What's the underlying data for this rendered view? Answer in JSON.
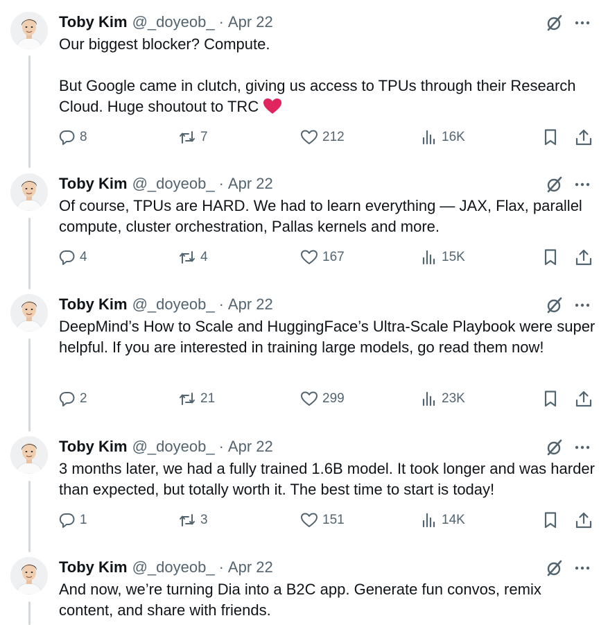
{
  "author": {
    "name": "Toby Kim",
    "handle": "@_doyeob_",
    "separator": "·"
  },
  "icons": {
    "reply": "reply-icon",
    "retweet": "retweet-icon",
    "like": "heart-icon",
    "views": "views-icon",
    "bookmark": "bookmark-icon",
    "share": "share-icon",
    "grok": "grok-icon",
    "more": "more-icon"
  },
  "colors": {
    "text": "#0f1419",
    "muted": "#536471",
    "thread_line": "#cfd9de",
    "heart_emoji": "#e0245e"
  },
  "tweets": [
    {
      "date": "Apr 22",
      "paragraphs": [
        "Our biggest blocker? Compute.",
        "But Google came in clutch, giving us access to TPUs through their Research Cloud. Huge shoutout to TRC"
      ],
      "emoji": "red-heart",
      "replies": "8",
      "retweets": "7",
      "likes": "212",
      "views": "16K"
    },
    {
      "date": "Apr 22",
      "paragraphs": [
        "Of course, TPUs are HARD. We had to learn everything — JAX, Flax, parallel compute, cluster orchestration, Pallas kernels and more."
      ],
      "replies": "4",
      "retweets": "4",
      "likes": "167",
      "views": "15K"
    },
    {
      "date": "Apr 22",
      "paragraphs": [
        "DeepMind’s How to Scale and HuggingFace’s Ultra-Scale Playbook were super helpful. If you are interested in training large models, go read them now!"
      ],
      "replies": "2",
      "retweets": "21",
      "likes": "299",
      "views": "23K"
    },
    {
      "date": "Apr 22",
      "paragraphs": [
        "3 months later, we had a fully trained 1.6B model. It took longer and was harder than expected, but totally worth it. The best time to start is today!"
      ],
      "replies": "1",
      "retweets": "3",
      "likes": "151",
      "views": "14K"
    },
    {
      "date": "Apr 22",
      "paragraphs": [
        "And now, we’re turning Dia into a B2C app. Generate fun convos, remix content, and share with friends."
      ]
    }
  ]
}
